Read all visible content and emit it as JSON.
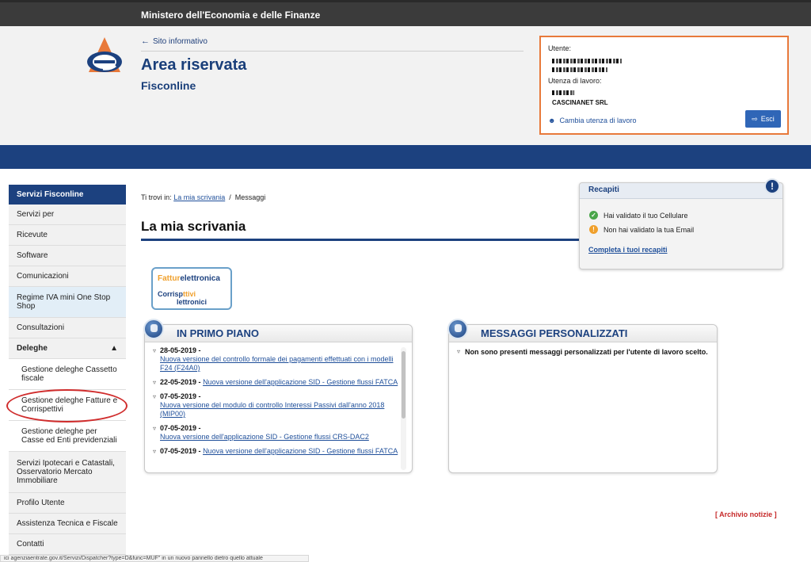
{
  "top": {
    "ministry": "Ministero dell'Economia e delle Finanze"
  },
  "header": {
    "info_link": "Sito informativo",
    "title": "Area riservata",
    "subtitle": "Fisconline",
    "colors": {
      "brand_blue": "#1c417f",
      "logo_orange": "#e8793a"
    }
  },
  "user": {
    "user_label": "Utente:",
    "work_label": "Utenza di lavoro:",
    "company": "CASCINANET SRL",
    "switch_label": "Cambia utenza di lavoro",
    "exit_label": "Esci"
  },
  "sidebar": {
    "heading": "Servizi Fisconline",
    "items": [
      {
        "label": "Servizi per"
      },
      {
        "label": "Ricevute"
      },
      {
        "label": "Software"
      },
      {
        "label": "Comunicazioni"
      },
      {
        "label": "Regime IVA mini One Stop Shop"
      },
      {
        "label": "Consultazioni"
      },
      {
        "label": "Deleghe"
      },
      {
        "label": "Gestione deleghe Cassetto fiscale"
      },
      {
        "label": "Gestione deleghe Fatture e Corrispettivi"
      },
      {
        "label": "Gestione deleghe per Casse ed Enti previdenziali"
      },
      {
        "label": "Servizi Ipotecari e Catastali, Osservatorio Mercato Immobiliare"
      },
      {
        "label": "Profilo Utente"
      },
      {
        "label": "Assistenza Tecnica e Fiscale"
      },
      {
        "label": "Contatti"
      }
    ]
  },
  "breadcrumb": {
    "prefix": "Ti trovi in:",
    "link": "La mia scrivania",
    "sep": "/",
    "current": "Messaggi"
  },
  "page": {
    "title": "La mia scrivania"
  },
  "recapiti": {
    "title": "Recapiti",
    "alert_glyph": "!",
    "phone_status": "Hai validato il tuo Cellulare",
    "email_status": "Non hai validato la tua Email",
    "complete_link": "Completa i tuoi recapiti"
  },
  "badge": {
    "fatture_a": "Fattur",
    "fatture_b": "elettronica",
    "corr_a": "Corrisp",
    "corr_b": "ttivi",
    "corr_c": "lettronici"
  },
  "primo_piano": {
    "title": "IN PRIMO PIANO",
    "items": [
      {
        "date": "28-05-2019 -",
        "text": "Nuova versione del controllo formale dei pagamenti effettuati con i modelli F24 (F24A0)"
      },
      {
        "date": "22-05-2019 -",
        "text": "Nuova versione dell'applicazione SID - Gestione flussi FATCA"
      },
      {
        "date": "07-05-2019 -",
        "text": "Nuova versione del modulo di controllo Interessi Passivi dall'anno 2018 (MIP00)"
      },
      {
        "date": "07-05-2019 -",
        "text": "Nuova versione dell'applicazione SID - Gestione flussi CRS-DAC2"
      },
      {
        "date": "07-05-2019 -",
        "text": "Nuova versione dell'applicazione SID - Gestione flussi FATCA"
      }
    ]
  },
  "messaggi": {
    "title": "MESSAGGI PERSONALIZZATI",
    "text": "Non sono presenti messaggi personalizzati per l'utente di lavoro scelto."
  },
  "archive": {
    "label": "[ Archivio notizie ]"
  },
  "status": {
    "url": "ici agenziaentrate.gov.it/Servizi/Dispatcher?type=D&func=MUF\" in un nuovo pannello dietro quello attuale"
  }
}
